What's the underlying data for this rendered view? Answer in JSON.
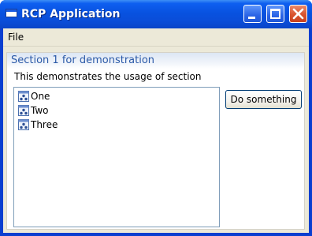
{
  "window": {
    "title": "RCP Application"
  },
  "menubar": {
    "items": [
      {
        "label": "File"
      }
    ]
  },
  "section": {
    "title": "Section 1 for demonstration",
    "description": "This demonstrates the usage of section"
  },
  "list": {
    "items": [
      {
        "label": "One",
        "icon": "tree-node-icon"
      },
      {
        "label": "Two",
        "icon": "tree-node-icon"
      },
      {
        "label": "Three",
        "icon": "tree-node-icon"
      }
    ]
  },
  "actions": {
    "do_something_label": "Do something"
  },
  "colors": {
    "titlebar": "#0852e0",
    "close_button": "#d9532e",
    "section_title": "#2c5aa8",
    "list_border": "#7f9db9",
    "window_face": "#ece9d8"
  }
}
